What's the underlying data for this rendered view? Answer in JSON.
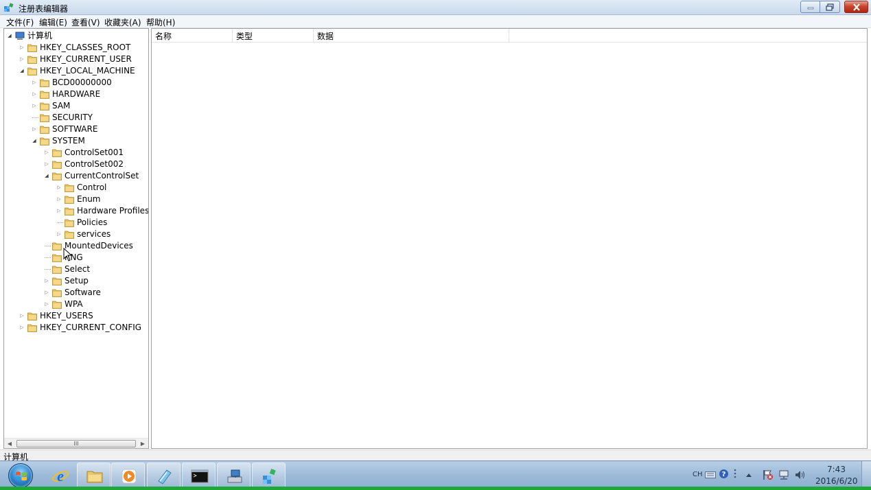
{
  "window": {
    "title": "注册表编辑器",
    "minimize_label": "",
    "restore_label": "",
    "close_label": ""
  },
  "menu": {
    "items": [
      {
        "label": "文件(F)"
      },
      {
        "label": "编辑(E)"
      },
      {
        "label": "查看(V)"
      },
      {
        "label": "收藏夹(A)"
      },
      {
        "label": "帮助(H)"
      }
    ]
  },
  "tree": {
    "nodes": [
      {
        "label": "计算机",
        "state": "expanded",
        "depth": 0,
        "icon": "computer-icon"
      },
      {
        "label": "HKEY_CLASSES_ROOT",
        "state": "collapsed",
        "depth": 1,
        "icon": "folder-icon"
      },
      {
        "label": "HKEY_CURRENT_USER",
        "state": "collapsed",
        "depth": 1,
        "icon": "folder-icon"
      },
      {
        "label": "HKEY_LOCAL_MACHINE",
        "state": "expanded",
        "depth": 1,
        "icon": "folder-icon"
      },
      {
        "label": "BCD00000000",
        "state": "collapsed",
        "depth": 2,
        "icon": "folder-icon"
      },
      {
        "label": "HARDWARE",
        "state": "collapsed",
        "depth": 2,
        "icon": "folder-icon"
      },
      {
        "label": "SAM",
        "state": "collapsed",
        "depth": 2,
        "icon": "folder-icon"
      },
      {
        "label": "SECURITY",
        "state": "leaf",
        "depth": 2,
        "icon": "folder-icon"
      },
      {
        "label": "SOFTWARE",
        "state": "collapsed",
        "depth": 2,
        "icon": "folder-icon"
      },
      {
        "label": "SYSTEM",
        "state": "expanded",
        "depth": 2,
        "icon": "folder-icon"
      },
      {
        "label": "ControlSet001",
        "state": "collapsed",
        "depth": 3,
        "icon": "folder-icon"
      },
      {
        "label": "ControlSet002",
        "state": "collapsed",
        "depth": 3,
        "icon": "folder-icon"
      },
      {
        "label": "CurrentControlSet",
        "state": "expanded",
        "depth": 3,
        "icon": "folder-icon"
      },
      {
        "label": "Control",
        "state": "collapsed",
        "depth": 4,
        "icon": "folder-icon"
      },
      {
        "label": "Enum",
        "state": "collapsed",
        "depth": 4,
        "icon": "folder-icon"
      },
      {
        "label": "Hardware Profiles",
        "state": "collapsed",
        "depth": 4,
        "icon": "folder-icon"
      },
      {
        "label": "Policies",
        "state": "leaf",
        "depth": 4,
        "icon": "folder-icon"
      },
      {
        "label": "services",
        "state": "collapsed",
        "depth": 4,
        "icon": "folder-icon"
      },
      {
        "label": "MountedDevices",
        "state": "leaf",
        "depth": 3,
        "icon": "folder-icon"
      },
      {
        "label": "RNG",
        "state": "leaf",
        "depth": 3,
        "icon": "folder-icon"
      },
      {
        "label": "Select",
        "state": "leaf",
        "depth": 3,
        "icon": "folder-icon"
      },
      {
        "label": "Setup",
        "state": "collapsed",
        "depth": 3,
        "icon": "folder-icon"
      },
      {
        "label": "Software",
        "state": "collapsed",
        "depth": 3,
        "icon": "folder-icon"
      },
      {
        "label": "WPA",
        "state": "collapsed",
        "depth": 3,
        "icon": "folder-icon"
      },
      {
        "label": "HKEY_USERS",
        "state": "collapsed",
        "depth": 1,
        "icon": "folder-icon"
      },
      {
        "label": "HKEY_CURRENT_CONFIG",
        "state": "collapsed",
        "depth": 1,
        "icon": "folder-icon"
      }
    ],
    "scroll_thumb_label": "III"
  },
  "list": {
    "columns": [
      {
        "label": "名称"
      },
      {
        "label": "类型"
      },
      {
        "label": "数据"
      }
    ],
    "rows": []
  },
  "status": {
    "path": "计算机"
  },
  "taskbar": {
    "apps": [
      {
        "name": "internet-explorer",
        "icon": "ie-icon",
        "active": false
      },
      {
        "name": "explorer",
        "icon": "folder-icon",
        "active": true
      },
      {
        "name": "media-player",
        "icon": "media-player-icon",
        "active": true
      },
      {
        "name": "notepad",
        "icon": "notepad-icon",
        "active": true
      },
      {
        "name": "command-prompt",
        "icon": "terminal-icon",
        "active": true
      },
      {
        "name": "network",
        "icon": "network-computer-icon",
        "active": true
      },
      {
        "name": "registry-editor",
        "icon": "regedit-icon",
        "active": true
      }
    ],
    "tray": {
      "language": "CH",
      "time": "7:43",
      "date": "2016/6/20"
    }
  },
  "colors": {
    "accent": "#2a7fc7",
    "close_button": "#c9452e",
    "folder": "#e8c260",
    "taskbar": "#9cb9d8"
  }
}
